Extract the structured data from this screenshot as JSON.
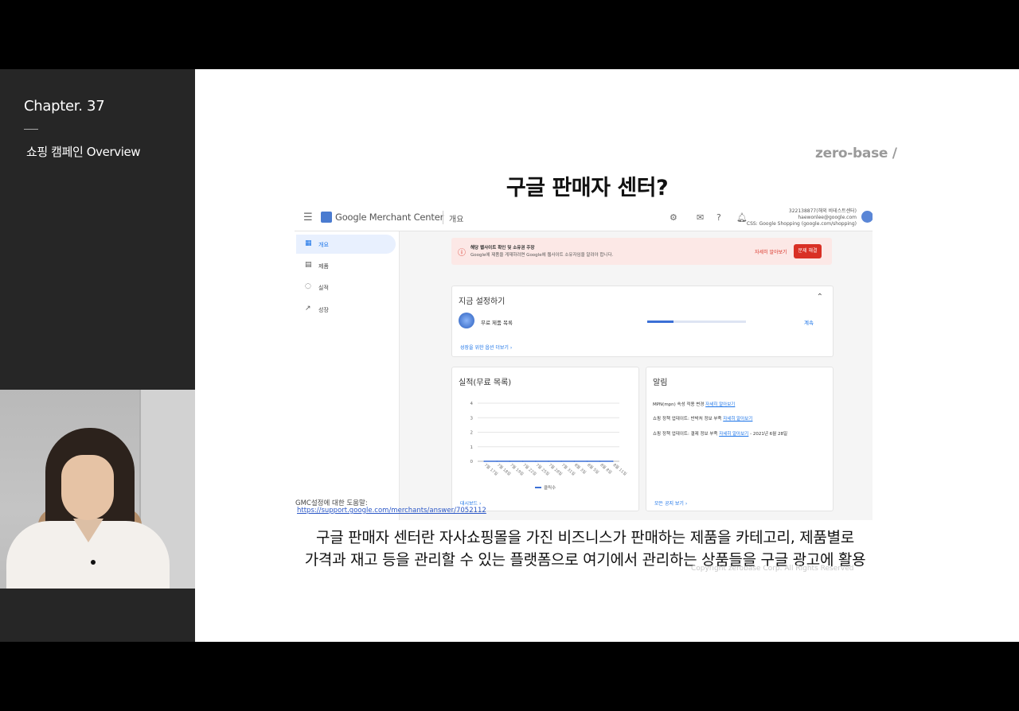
{
  "sidebar": {
    "chapter": "Chapter. 37",
    "course_title": "쇼핑 캠페인 Overview"
  },
  "slide": {
    "logo": "zero-base /",
    "title": "구글 판매자 센터?",
    "help_label": "GMC설정에 대한 도움말:",
    "help_url": "https://support.google.com/merchants/answer/7052112",
    "caption_line1": "구글 판매자 센터란 자사쇼핑몰을 가진 비즈니스가 판매하는 제품을 카테고리, 제품별로",
    "caption_line2": "가격과 재고 등을 관리할 수 있는 플랫폼으로 여기에서 관리하는 상품들을 구글 광고에 활용",
    "copyright": "Copyright zerobase Corp. All Rights Reserved"
  },
  "gmc": {
    "brand": "Google Merchant Center",
    "page": "개요",
    "account_id": "322138877(해외 비테스트센터)",
    "account_email": "haewonlee@google.com",
    "account_css": "CSS: Google Shopping (google.com/shopping)",
    "nav": [
      {
        "label": "개요",
        "icon": "overview-icon",
        "glyph": "▦"
      },
      {
        "label": "제품",
        "icon": "products-icon",
        "glyph": "▤"
      },
      {
        "label": "실적",
        "icon": "performance-icon",
        "glyph": "◌"
      },
      {
        "label": "성장",
        "icon": "growth-icon",
        "glyph": "↗"
      }
    ],
    "alert": {
      "title": "해당 웹사이트 확인 및 소유권 주장",
      "text": "Google에 제품을 게재하려면 Google에 웹사이트 소유자임을 알려야 합니다.",
      "learn_more": "자세히 알아보기",
      "fix": "문제 해결"
    },
    "setup": {
      "title": "지금 설정하기",
      "item": "무료 제품 목록",
      "progress": 0.27,
      "continue": "계속",
      "more": "성장을 위한 옵션 더보기 ›"
    },
    "performance": {
      "title": "실적(무료 목록)",
      "footer": "대시보드 ›",
      "legend": "클릭수"
    },
    "notifications": {
      "title": "알림",
      "items": [
        {
          "text": "MPN(mpn) 속성 적용 변경",
          "link": "자세히 알아보기",
          "suffix": ""
        },
        {
          "text": "쇼핑 정책 업데이트: 반박처 정보 부족",
          "link": "자세히 알아보기",
          "suffix": ""
        },
        {
          "text": "쇼핑 정책 업데이트: 결제 정보 부족",
          "link": "자세히 알아보기",
          "suffix": " - 2021년 6월 28일"
        }
      ],
      "footer": "모든 공지 보기 ›"
    }
  },
  "chart_data": {
    "type": "line",
    "title": "실적(무료 목록)",
    "xlabel": "",
    "ylabel": "",
    "x": [
      "7월 17일",
      "7월 18일",
      "7월 19일",
      "7월 22일",
      "7월 25일",
      "7월 28일",
      "7월 31일",
      "8월 3일",
      "8월 5일",
      "8월 8일",
      "8월 11일"
    ],
    "ylim": [
      0,
      4
    ],
    "yticks": [
      0,
      1,
      2,
      3,
      4
    ],
    "grid": true,
    "legend": "bottom",
    "series": [
      {
        "name": "클릭수",
        "values": [
          0,
          0,
          0,
          0,
          0,
          0,
          0,
          0,
          0,
          0,
          0
        ],
        "color": "#3b6fd6"
      }
    ]
  }
}
